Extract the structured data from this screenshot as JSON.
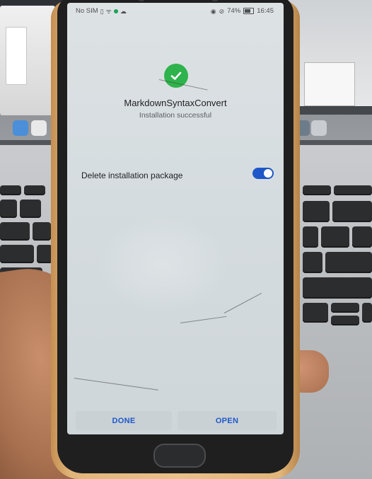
{
  "status_bar": {
    "carrier": "No SIM",
    "battery": "74%",
    "time": "16:45",
    "icons": [
      "sim-icon",
      "wifi-icon",
      "dot-icon",
      "cloud-icon",
      "eye-icon",
      "mute-icon",
      "battery-icon"
    ]
  },
  "install": {
    "app_name": "MarkdownSyntaxConvert",
    "status": "Installation successful",
    "success_color": "#2fb34c"
  },
  "options": {
    "delete_label": "Delete installation package",
    "delete_enabled": true,
    "accent_color": "#1f57c9"
  },
  "buttons": {
    "done": "DONE",
    "open": "OPEN"
  }
}
